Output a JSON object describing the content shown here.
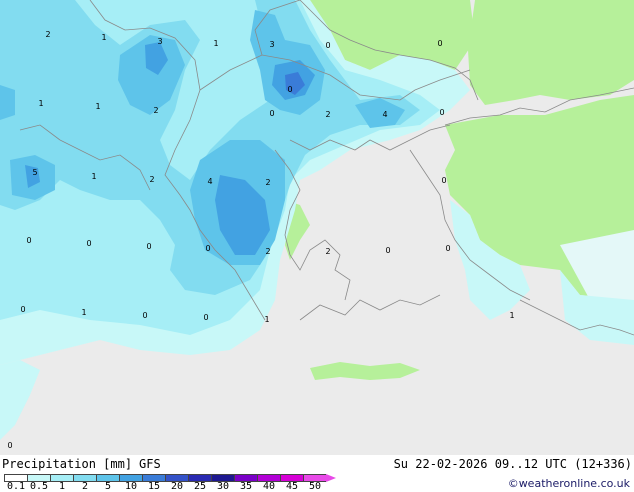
{
  "title": {
    "variable": "Precipitation [mm]",
    "model": "GFS",
    "datetime": "Su 22-02-2026 09..12 UTC (12+336)"
  },
  "credit": "©weatheronline.co.uk",
  "legend": {
    "ticks": [
      "0.1",
      "0.5",
      "1",
      "2",
      "5",
      "10",
      "15",
      "20",
      "25",
      "30",
      "35",
      "40",
      "45",
      "50"
    ],
    "colors": [
      "#ffffff",
      "#c8f8f8",
      "#a6eef6",
      "#82dcf0",
      "#5ec4ea",
      "#42a2e2",
      "#3a7cd8",
      "#3452c8",
      "#2a2ab2",
      "#1e1890",
      "#7a00c8",
      "#b200d6",
      "#d600d6",
      "#e84ae8"
    ]
  },
  "map": {
    "colors": {
      "sea_no_precip": "#ebebeb",
      "land_green": "#b6f09a",
      "land_gray": "#d6d6d6",
      "precip_light": "#c8f8f8",
      "precip_low": "#a6eef6",
      "precip_mid": "#82dcf0",
      "precip_high": "#5ec4ea",
      "precip_heavy": "#42a2e2",
      "precip_max": "#3a7cd8"
    },
    "labels": [
      "2",
      "1",
      "3",
      "1",
      "3",
      "0",
      "0",
      "1",
      "1",
      "2",
      "0",
      "2",
      "4",
      "0",
      "5",
      "1",
      "2",
      "4",
      "2",
      "0",
      "0",
      "0",
      "0",
      "0",
      "2",
      "2",
      "0",
      "0",
      "0",
      "1",
      "0",
      "0",
      "1",
      "1",
      "0",
      "0"
    ]
  }
}
